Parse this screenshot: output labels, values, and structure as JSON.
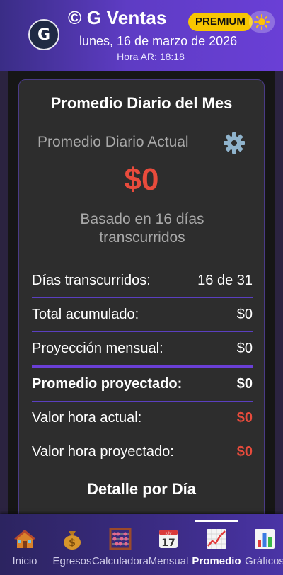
{
  "header": {
    "avatar_letter": "G",
    "app_title": "© G Ventas",
    "premium_badge": "PREMIUM",
    "date": "lunes, 16 de marzo de 2026",
    "time": "Hora AR: 18:18"
  },
  "card": {
    "title": "Promedio Diario del Mes",
    "current_label": "Promedio Diario Actual",
    "current_value": "$0",
    "basis": "Basado en 16 días transcurridos",
    "rows": [
      {
        "label": "Días transcurridos:",
        "value": "16 de 31"
      },
      {
        "label": "Total acumulado:",
        "value": "$0"
      },
      {
        "label": "Proyección mensual:",
        "value": "$0"
      },
      {
        "label": "Promedio proyectado:",
        "value": "$0"
      },
      {
        "label": "Valor hora actual:",
        "value": "$0"
      },
      {
        "label": "Valor hora proyectado:",
        "value": "$0"
      }
    ],
    "detail_title": "Detalle por Día"
  },
  "nav": {
    "items": [
      {
        "label": "Inicio",
        "icon": "house-icon"
      },
      {
        "label": "Egresos",
        "icon": "money-bag-icon"
      },
      {
        "label": "Calculadora",
        "icon": "abacus-icon"
      },
      {
        "label": "Mensual",
        "icon": "calendar-icon"
      },
      {
        "label": "Promedio",
        "icon": "chart-increasing-icon"
      },
      {
        "label": "Gráficos",
        "icon": "bar-chart-icon"
      }
    ],
    "active": "Promedio",
    "calendar_month": "July",
    "calendar_day": "17"
  },
  "colors": {
    "accent": "#6a3fd6",
    "premium": "#f7c600",
    "negative": "#e84b3c",
    "card_bg": "#2d2d2d"
  }
}
